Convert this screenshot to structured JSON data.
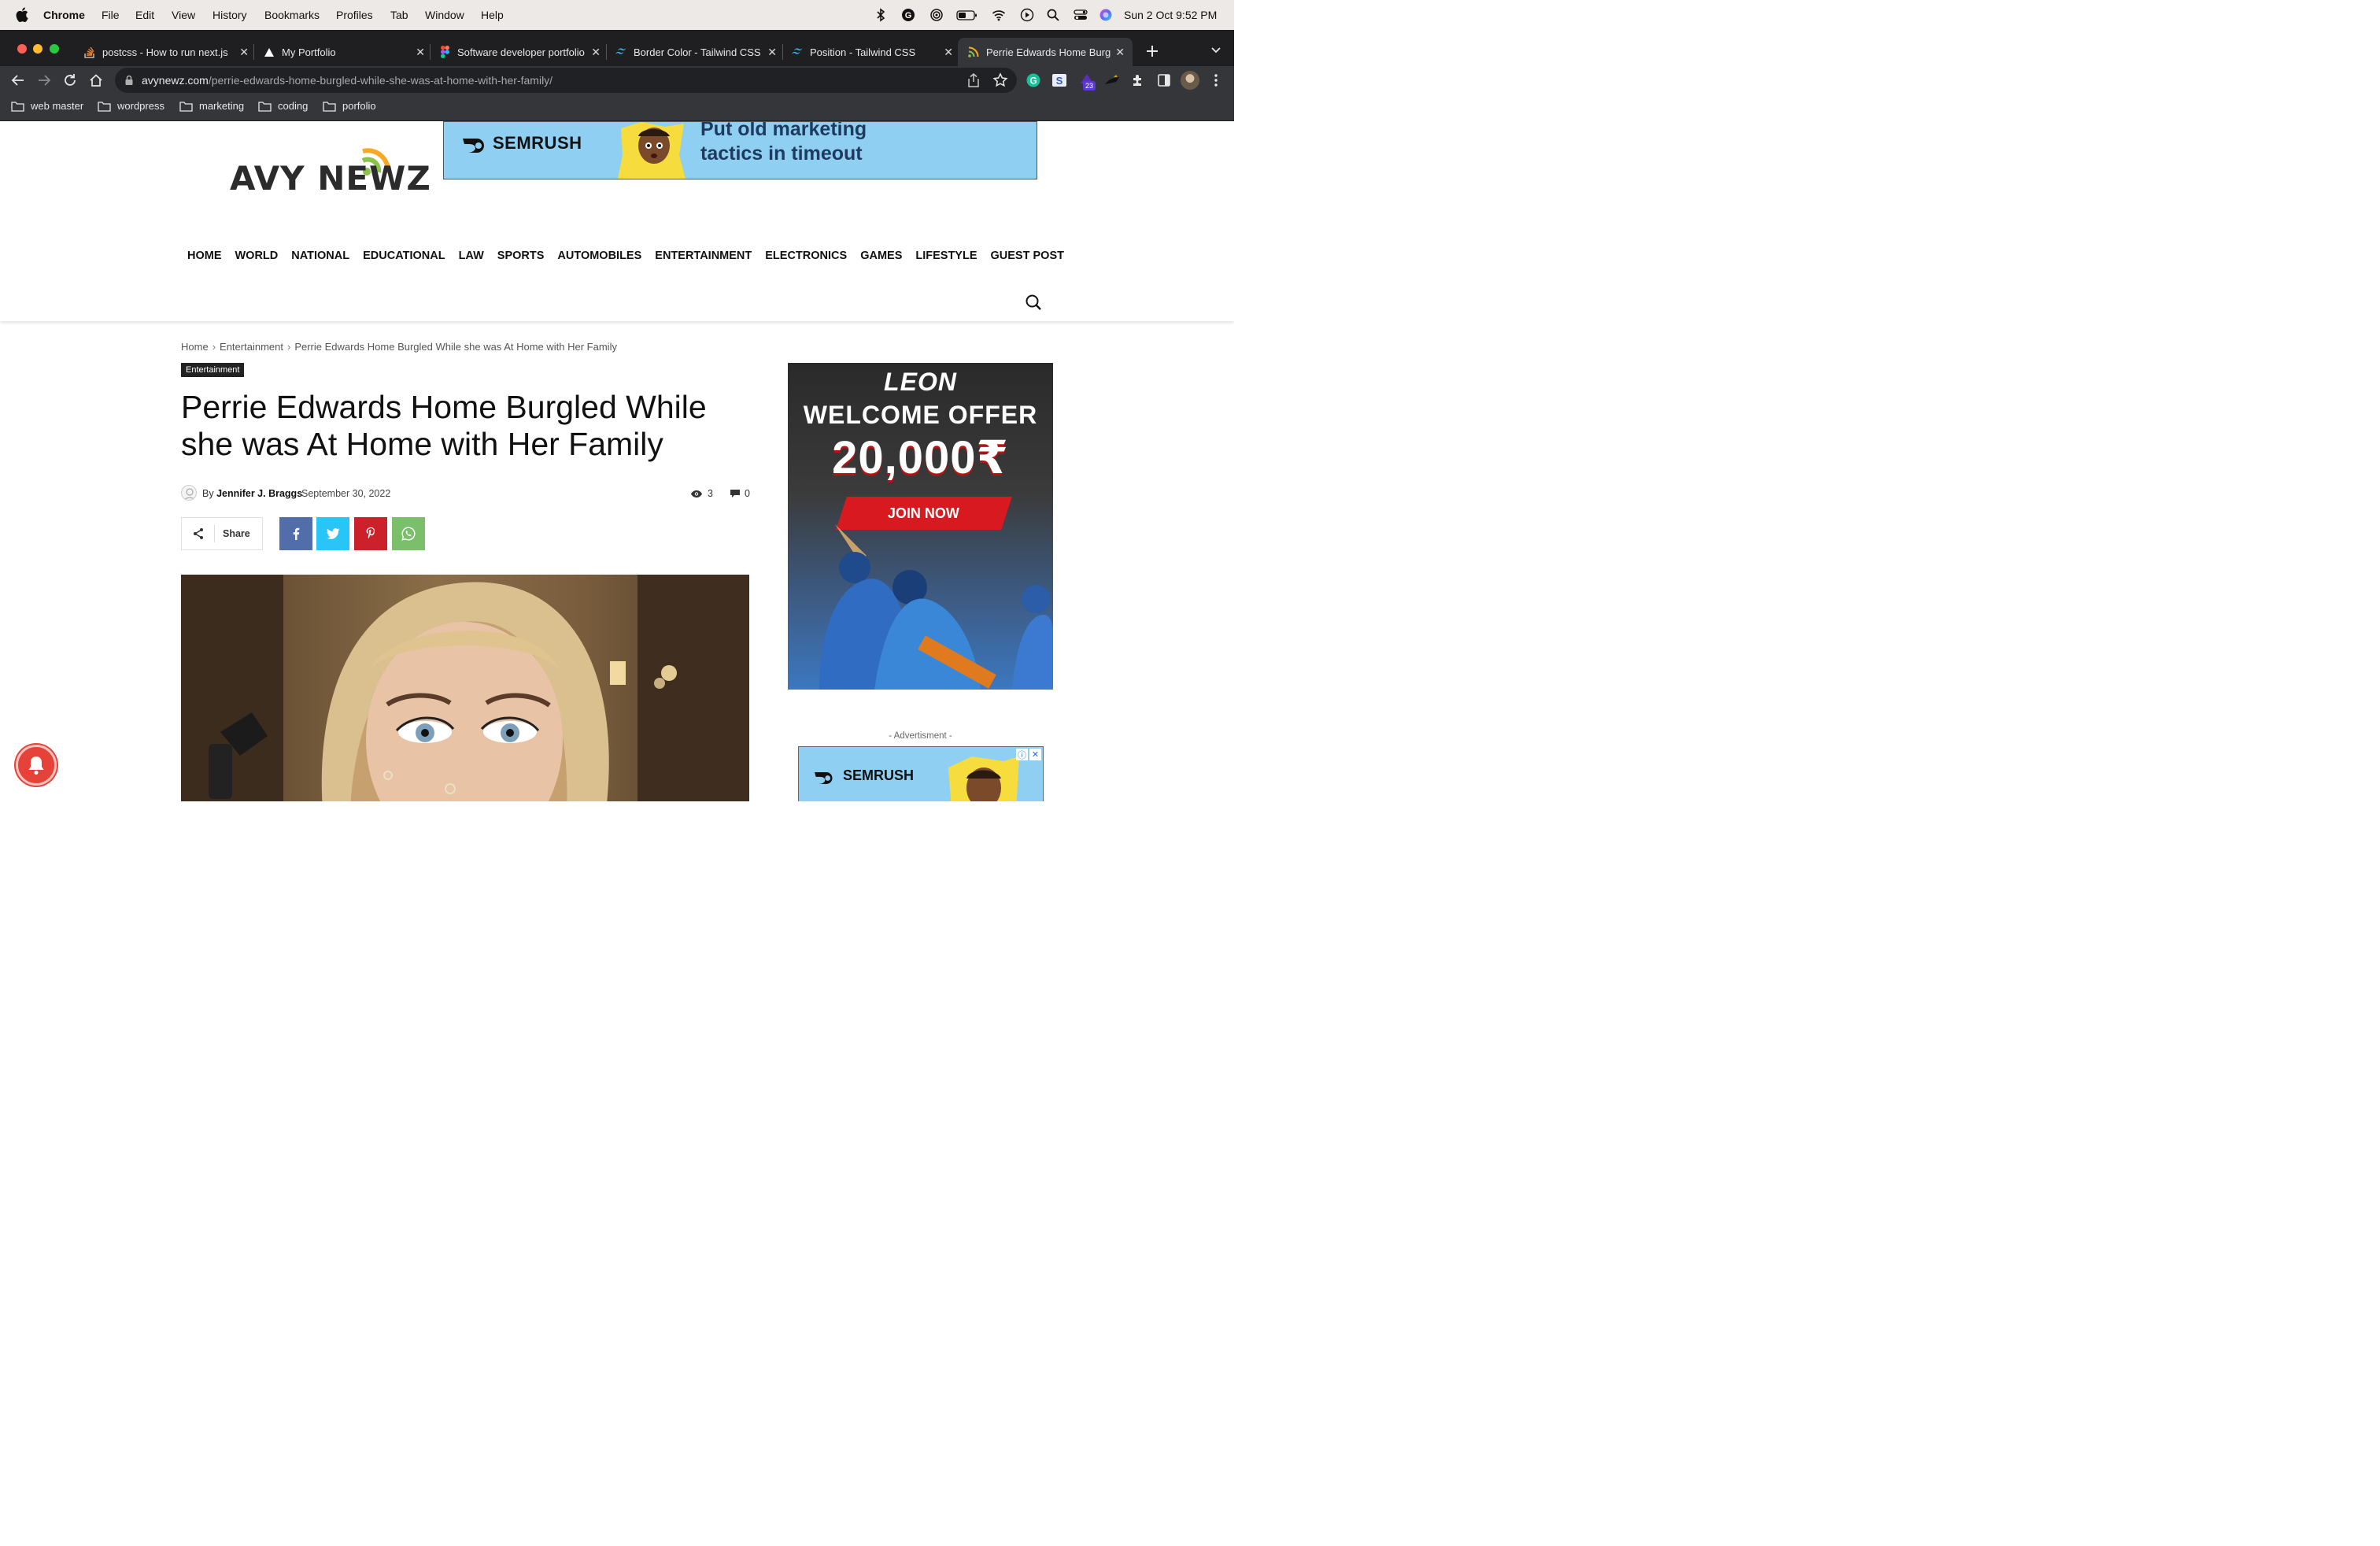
{
  "menubar": {
    "app": "Chrome",
    "items": [
      "File",
      "Edit",
      "View",
      "History",
      "Bookmarks",
      "Profiles",
      "Tab",
      "Window",
      "Help"
    ],
    "clock": "Sun 2 Oct  9:52 PM"
  },
  "tabs": [
    {
      "title": "postcss - How to run next.js",
      "icon": "stackoverflow-icon"
    },
    {
      "title": "My Portfolio",
      "icon": "vercel-icon"
    },
    {
      "title": "Software developer portfolio",
      "icon": "figma-icon"
    },
    {
      "title": "Border Color - Tailwind CSS",
      "icon": "tailwind-icon"
    },
    {
      "title": "Position - Tailwind CSS",
      "icon": "tailwind-icon"
    },
    {
      "title": "Perrie Edwards Home Burgled",
      "icon": "rss-icon"
    }
  ],
  "address": {
    "domain": "avynewz.com",
    "path": "/perrie-edwards-home-burgled-while-she-was-at-home-with-her-family/"
  },
  "extension_badge": "23",
  "bookmarks": [
    "web master",
    "wordpress",
    "marketing",
    "coding",
    "porfolio"
  ],
  "site": {
    "logo": "AVY NEWZ",
    "top_ad": {
      "brand": "SEMRUSH",
      "tagline_line1": "Put old marketing",
      "tagline_line2": "tactics in timeout"
    },
    "nav": [
      "HOME",
      "WORLD",
      "NATIONAL",
      "EDUCATIONAL",
      "LAW",
      "SPORTS",
      "AUTOMOBILES",
      "ENTERTAINMENT",
      "ELECTRONICS",
      "GAMES",
      "LIFESTYLE",
      "GUEST POST"
    ]
  },
  "article": {
    "breadcrumbs": [
      "Home",
      "Entertainment",
      "Perrie Edwards Home Burgled While she was At Home with Her Family"
    ],
    "category": "Entertainment",
    "title": "Perrie Edwards Home Burgled While she was At Home with Her Family",
    "by_label": "By",
    "author": "Jennifer J. Braggs",
    "date": "September 30, 2022",
    "views": "3",
    "comments": "0",
    "share_label": "Share",
    "share_buttons": [
      {
        "name": "facebook",
        "color": "#516eab"
      },
      {
        "name": "twitter",
        "color": "#29c5f6"
      },
      {
        "name": "pinterest",
        "color": "#ca212a"
      },
      {
        "name": "whatsapp",
        "color": "#7bbf6a"
      }
    ]
  },
  "sidebar": {
    "ad1": {
      "brand": "LEON",
      "headline": "WELCOME OFFER",
      "amount": "20,000₹",
      "cta": "JOIN NOW"
    },
    "adv_label": "- Advertisment -",
    "ad2": {
      "brand": "SEMRUSH"
    }
  },
  "colors": {
    "accent": "#222222",
    "semrush_bg": "#8fd0f2",
    "bell": "#e5433a"
  }
}
